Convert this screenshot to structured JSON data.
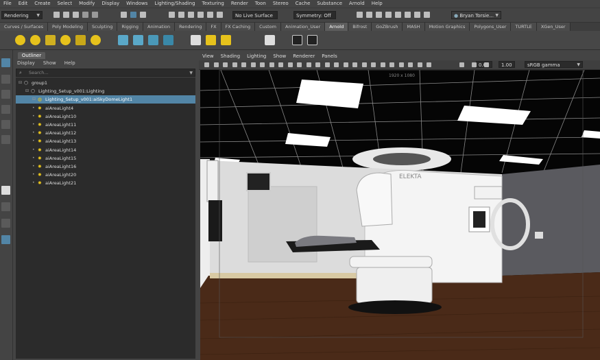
{
  "menubar": [
    "File",
    "Edit",
    "Create",
    "Select",
    "Modify",
    "Display",
    "Windows",
    "Lighting/Shading",
    "Texturing",
    "Render",
    "Toon",
    "Stereo",
    "Cache",
    "Substance",
    "Arnold",
    "Help"
  ],
  "statusline": {
    "mode": "Rendering",
    "live_surface": "No Live Surface",
    "symmetry": "Symmetry: Off",
    "user": "Bryan Torsie..."
  },
  "shelf_tabs": [
    "Curves / Surfaces",
    "Poly Modeling",
    "Sculpting",
    "Rigging",
    "Animation",
    "Rendering",
    "FX",
    "FX Caching",
    "Custom",
    "Animation_User",
    "Arnold",
    "Bifrost",
    "GoZBrush",
    "MASH",
    "Motion Graphics",
    "Polygons_User",
    "TURTLE",
    "XGen_User"
  ],
  "active_shelf_tab": "Arnold",
  "outliner": {
    "title": "Outliner",
    "menu": [
      "Display",
      "Show",
      "Help"
    ],
    "search_placeholder": "Search...",
    "items": [
      {
        "label": "group1",
        "depth": 0,
        "icon": "group-icon"
      },
      {
        "label": "Lighting_Setup_v001:Lighting",
        "depth": 1,
        "icon": "group-icon"
      },
      {
        "label": "Lighting_Setup_v001:aiSkyDomeLight1",
        "depth": 2,
        "icon": "skydome-light-icon",
        "selected": true
      },
      {
        "label": "aiAreaLight4",
        "depth": 2,
        "icon": "area-light-icon"
      },
      {
        "label": "aiAreaLight10",
        "depth": 2,
        "icon": "area-light-icon"
      },
      {
        "label": "aiAreaLight11",
        "depth": 2,
        "icon": "area-light-icon"
      },
      {
        "label": "aiAreaLight12",
        "depth": 2,
        "icon": "area-light-icon"
      },
      {
        "label": "aiAreaLight13",
        "depth": 2,
        "icon": "area-light-icon"
      },
      {
        "label": "aiAreaLight14",
        "depth": 2,
        "icon": "area-light-icon"
      },
      {
        "label": "aiAreaLight15",
        "depth": 2,
        "icon": "area-light-icon"
      },
      {
        "label": "aiAreaLight16",
        "depth": 2,
        "icon": "area-light-icon"
      },
      {
        "label": "aiAreaLight20",
        "depth": 2,
        "icon": "area-light-icon"
      },
      {
        "label": "aiAreaLight21",
        "depth": 2,
        "icon": "area-light-icon"
      }
    ]
  },
  "viewport": {
    "menu": [
      "View",
      "Shading",
      "Lighting",
      "Show",
      "Renderer",
      "Panels"
    ],
    "exposure": "0.00",
    "gamma": "1.00",
    "color_space": "sRGB gamma",
    "resolution": "1920 x 1080",
    "machine_logo": "ELEKTA"
  },
  "colors": {
    "accent": "#5285a6",
    "panel": "#444444",
    "field": "#2b2b2b"
  }
}
